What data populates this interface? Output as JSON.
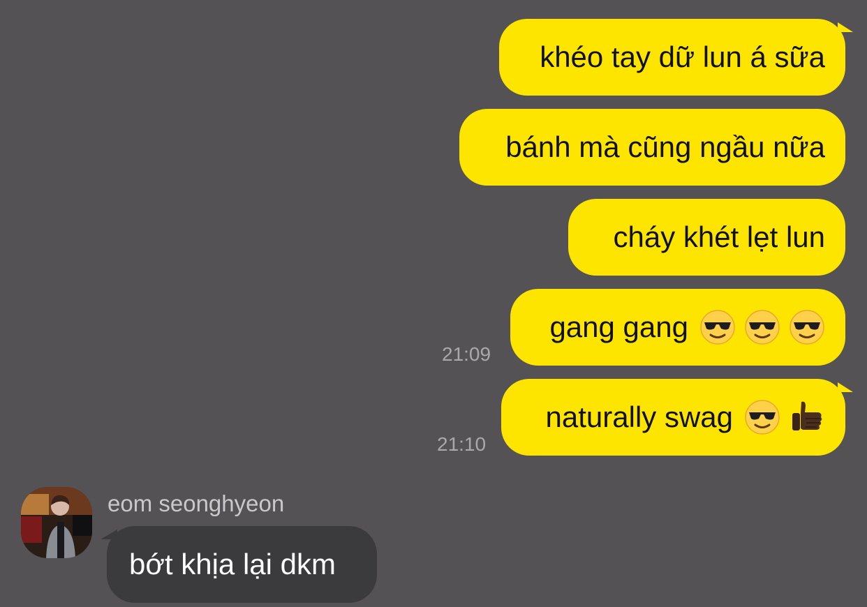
{
  "colors": {
    "background": "#545254",
    "outgoing_bubble": "#fee500",
    "incoming_bubble": "#3b3a3c",
    "timestamp": "#a9a8ab"
  },
  "messages_out": [
    {
      "text": "khéo tay dữ lun á sữa",
      "emojis": []
    },
    {
      "text": "bánh mà cũng ngầu nữa",
      "emojis": []
    },
    {
      "text": "cháy khét lẹt lun",
      "emojis": []
    },
    {
      "text": "gang gang",
      "emojis": [
        "sunglasses-emoji-icon",
        "sunglasses-emoji-icon",
        "sunglasses-emoji-icon"
      ],
      "time": "21:09"
    },
    {
      "text": "naturally swag",
      "emojis": [
        "sunglasses-emoji-icon",
        "thumbs-up-emoji-icon"
      ],
      "time": "21:10"
    }
  ],
  "incoming": {
    "sender_name": "eom seonghyeon",
    "avatar_icon": "profile-photo-avatar",
    "text": "bớt khịa lại dkm"
  }
}
